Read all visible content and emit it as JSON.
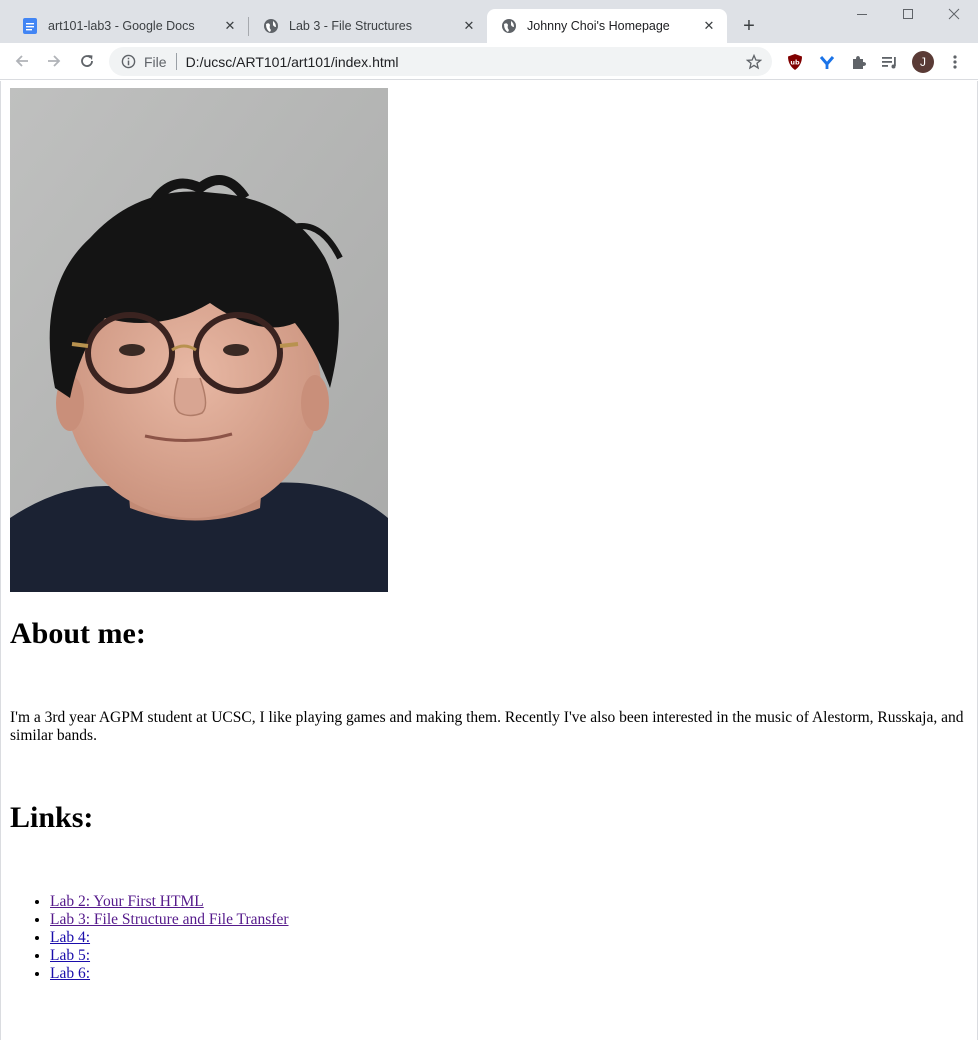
{
  "browser": {
    "tabs": [
      {
        "title": "art101-lab3 - Google Docs",
        "icon": "google-docs-icon",
        "active": false
      },
      {
        "title": "Lab 3 - File Structures",
        "icon": "globe-icon",
        "active": false
      },
      {
        "title": "Johnny Choi's Homepage",
        "icon": "globe-icon",
        "active": true
      }
    ],
    "address": {
      "scheme_label": "File",
      "url": "D:/ucsc/ART101/art101/index.html"
    },
    "profile_initial": "J",
    "colors": {
      "tabstrip": "#dee1e6",
      "omnibox": "#f1f3f4",
      "ublock": "#800000",
      "avatar": "#5a3b36"
    }
  },
  "page": {
    "photo_alt": "portrait-photo",
    "about_heading": "About me:",
    "bio": "I'm a 3rd year AGPM student at UCSC, I like playing games and making them. Recently I've also been interested in the music of Alestorm, Russkaja, and similar bands.",
    "links_heading": "Links:",
    "links": [
      {
        "label": "Lab 2: Your First HTML",
        "visited": true
      },
      {
        "label": "Lab 3: File Structure and File Transfer",
        "visited": true
      },
      {
        "label": "Lab 4:",
        "visited": false
      },
      {
        "label": "Lab 5:",
        "visited": false
      },
      {
        "label": "Lab 6:",
        "visited": false
      }
    ]
  }
}
